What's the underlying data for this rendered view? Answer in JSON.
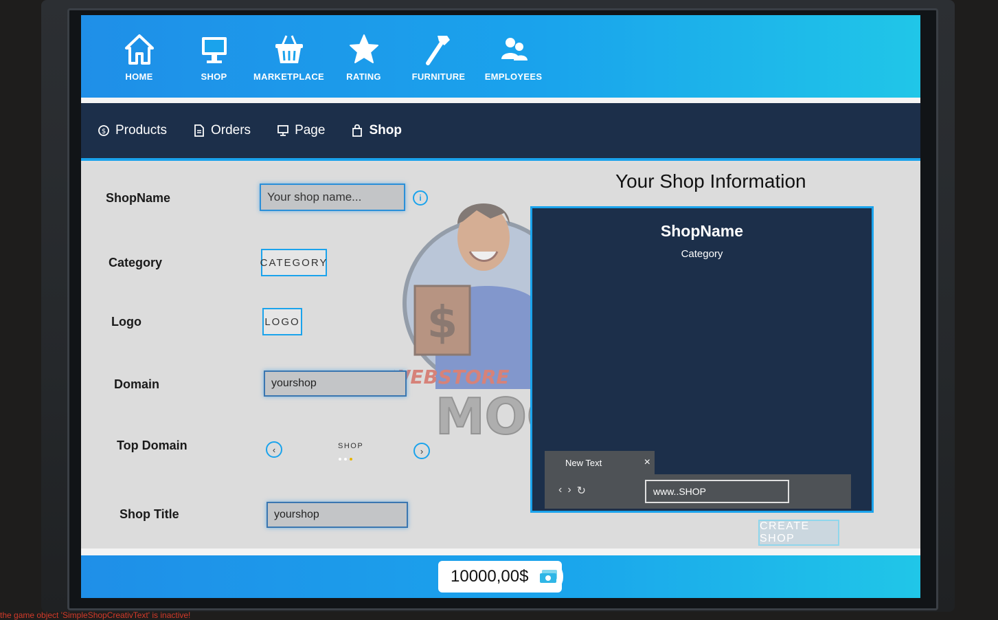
{
  "top_nav": [
    {
      "label": "HOME",
      "icon": "home-icon"
    },
    {
      "label": "SHOP",
      "icon": "monitor-icon"
    },
    {
      "label": "MARKETPLACE",
      "icon": "basket-icon"
    },
    {
      "label": "RATING",
      "icon": "star-icon"
    },
    {
      "label": "FURNITURE",
      "icon": "hammer-icon"
    },
    {
      "label": "EMPLOYEES",
      "icon": "users-icon"
    }
  ],
  "sub_nav": [
    {
      "label": "Products",
      "icon": "dollar-coin-icon"
    },
    {
      "label": "Orders",
      "icon": "document-icon"
    },
    {
      "label": "Page",
      "icon": "monitor-icon"
    },
    {
      "label": "Shop",
      "icon": "shopping-bag-icon"
    }
  ],
  "form": {
    "shopname_label": "ShopName",
    "shopname_placeholder": "Your shop name...",
    "category_label": "Category",
    "category_button": "CATEGORY",
    "logo_label": "Logo",
    "logo_button": "LOGO",
    "domain_label": "Domain",
    "domain_value": "yourshop",
    "top_domain_label": "Top Domain",
    "top_domain_value": "SHOP",
    "shop_title_label": "Shop Title",
    "shop_title_value": "yourshop"
  },
  "mascot": {
    "brand_line1": "WEBSTORE",
    "brand_line2": "MOG"
  },
  "preview": {
    "title": "Your Shop Information",
    "shop_name": "ShopName",
    "category": "Category",
    "tab_label": "New Text",
    "tab_close": "×",
    "url": "www..SHOP"
  },
  "create_button": "CREATE SHOP",
  "balance": "10000,00$",
  "console_error": "the game object 'SimpleShopCreativText' is inactive!",
  "colors": {
    "accent": "#1aa3ec",
    "nav_dark": "#1c2f4a"
  }
}
